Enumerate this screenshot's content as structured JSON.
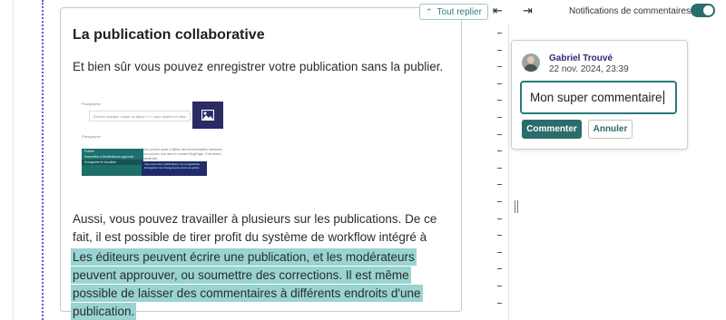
{
  "toolbar": {
    "collapse_all_label": "Tout replier",
    "notifications_label": "Notifications de commentaires",
    "notifications_enabled": true
  },
  "block": {
    "title": "La publication collaborative",
    "paragraph_1": "Et bien sûr vous pouvez enregistrer votre publication sans la publier.",
    "paragraph_2": "Aussi, vous pouvez travailler à plusieurs sur les publications. De ce fait, il est possible de tirer profit du système de workflow intégré à Wagtail.",
    "paragraph_3": "Les éditeurs peuvent écrire une publication, et les modérateurs peuvent approuver, ou soumettre des corrections. Il est même possible de laisser des commentaires à différents endroits d'une publication.",
    "paragraph_3_highlighted": true
  },
  "preview": {
    "block_label_1": "Paragraphe",
    "input_placeholder": "Écrivez quelque chose ou tapez « / » pour insérer un bloc",
    "block_label_2": "Paragraphe",
    "side_text": "Vous pouvez aussi d'utiliser des fonctionnalités avancées. Vous pouvez voir dans le modèle BlogPage. C'est assez maintenant.",
    "menu_items": [
      "Publier",
      "Soumettre à Modérateurs approval",
      "Enregistrer le brouillon"
    ],
    "tooltip_text": "Vous avez des modifications non enregistrées. Enregistrer vos changements avant de quitter.",
    "image_icon": "image-icon"
  },
  "comment": {
    "author": "Gabriel Trouvé",
    "timestamp": "22 nov. 2024, 23:39",
    "draft_text": "Mon super commentaire",
    "submit_label": "Commenter",
    "cancel_label": "Annuler"
  },
  "icons": {
    "collapse": "collapse-up-icon",
    "panel_left": "arrow-to-left-icon",
    "panel_right": "arrow-to-right-icon",
    "avatar": "user-avatar"
  },
  "colors": {
    "accent": "#2b6d6a",
    "highlight": "#99d4d2",
    "author": "#2d2a7a"
  }
}
